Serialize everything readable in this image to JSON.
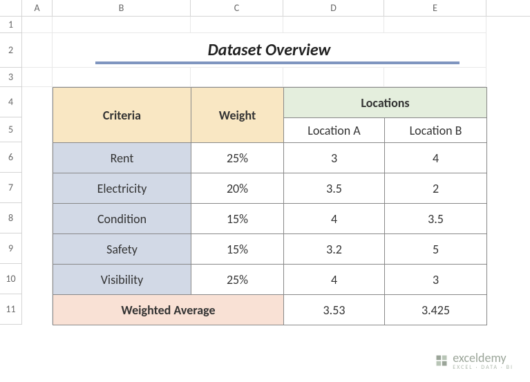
{
  "columns": {
    "A": "A",
    "B": "B",
    "C": "C",
    "D": "D",
    "E": "E"
  },
  "row_numbers": [
    "1",
    "2",
    "3",
    "4",
    "5",
    "6",
    "7",
    "8",
    "9",
    "10",
    "11"
  ],
  "title": "Dataset Overview",
  "headers": {
    "criteria": "Criteria",
    "weight": "Weight",
    "locations": "Locations",
    "loc_a": "Location A",
    "loc_b": "Location B"
  },
  "rows": [
    {
      "criteria": "Rent",
      "weight": "25%",
      "a": "3",
      "b": "4"
    },
    {
      "criteria": "Electricity",
      "weight": "20%",
      "a": "3.5",
      "b": "2"
    },
    {
      "criteria": "Condition",
      "weight": "15%",
      "a": "4",
      "b": "3.5"
    },
    {
      "criteria": "Safety",
      "weight": "15%",
      "a": "3.2",
      "b": "5"
    },
    {
      "criteria": "Visibility",
      "weight": "25%",
      "a": "4",
      "b": "3"
    }
  ],
  "footer": {
    "label": "Weighted Average",
    "a": "3.53",
    "b": "3.425"
  },
  "watermark": {
    "brand": "exceldemy",
    "tagline": "EXCEL · DATA · BI"
  },
  "layout": {
    "col_widths": {
      "A": 44,
      "B": 200,
      "C": 134,
      "D": 146,
      "E": 148
    },
    "row_heights": {
      "1": 24,
      "2": 50,
      "3": 28,
      "default": 44,
      "5": 36
    }
  }
}
